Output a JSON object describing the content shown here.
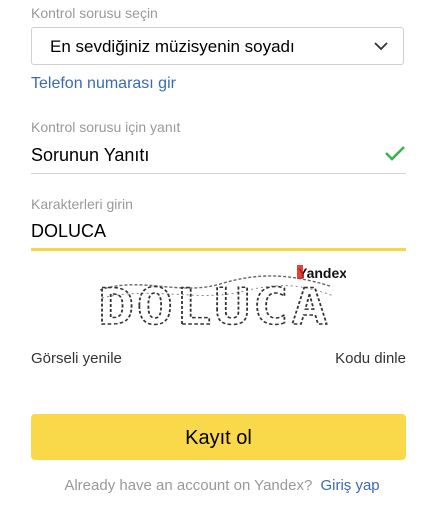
{
  "security_question": {
    "label": "Kontrol sorusu seçin",
    "selected": "En sevdiğiniz müzisyenin soyadı",
    "chevron_icon": "chevron-down-icon"
  },
  "phone_link": "Telefon numarası gir",
  "answer": {
    "label": "Kontrol sorusu için yanıt",
    "value": "Sorunun Yanıtı",
    "status_icon": "checkmark-icon",
    "status_color": "#3db24f"
  },
  "captcha": {
    "label": "Karakterleri girin",
    "value": "DOLUCA",
    "image_text": "DOLUCA",
    "brand": "Yandex",
    "refresh_label": "Görseli yenile",
    "listen_label": "Kodu dinle"
  },
  "submit_label": "Kayıt ol",
  "login": {
    "prompt": "Already have an account on Yandex?",
    "link": "Giriş yap"
  },
  "colors": {
    "accent_yellow": "#f9d84a",
    "link_blue": "#3a6ab5",
    "brand_red": "#e0201b"
  }
}
